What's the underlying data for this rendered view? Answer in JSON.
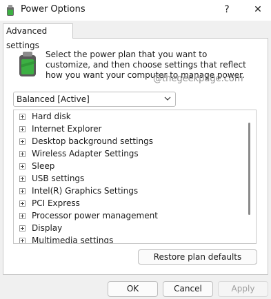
{
  "window": {
    "title": "Power Options",
    "help_glyph": "?",
    "close_glyph": "✕"
  },
  "tab": {
    "label": "Advanced settings"
  },
  "description": "Select the power plan that you want to customize, and then choose settings that reflect how you want your computer to manage power.",
  "watermark": "@thegeekpage.com",
  "plan_select": {
    "value": "Balanced [Active]"
  },
  "settings_tree": [
    {
      "label": "Hard disk",
      "icon": "expand-plus-icon"
    },
    {
      "label": "Internet Explorer",
      "icon": "expand-plus-icon"
    },
    {
      "label": "Desktop background settings",
      "icon": "expand-plus-icon"
    },
    {
      "label": "Wireless Adapter Settings",
      "icon": "expand-plus-icon"
    },
    {
      "label": "Sleep",
      "icon": "expand-plus-icon"
    },
    {
      "label": "USB settings",
      "icon": "expand-plus-icon"
    },
    {
      "label": "Intel(R) Graphics Settings",
      "icon": "expand-plus-icon"
    },
    {
      "label": "PCI Express",
      "icon": "expand-plus-icon"
    },
    {
      "label": "Processor power management",
      "icon": "expand-plus-icon"
    },
    {
      "label": "Display",
      "icon": "expand-plus-icon"
    },
    {
      "label": "Multimedia settings",
      "icon": "expand-plus-icon"
    }
  ],
  "buttons": {
    "restore": "Restore plan defaults",
    "ok": "OK",
    "cancel": "Cancel",
    "apply": "Apply"
  },
  "colors": {
    "battery_green": "#3cb043",
    "battery_body": "#5a5a5a"
  }
}
